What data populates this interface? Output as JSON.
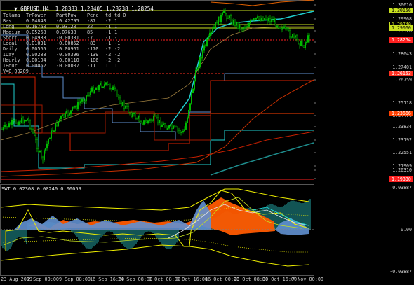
{
  "chart_header": {
    "arrow": "▼",
    "text": "GBPUSD,H4  1.28383 1.28405 1.28238 1.28254"
  },
  "indicator_header": {
    "text": "SWT 0.02308 0.00240 0.00059"
  },
  "table": {
    "columns": [
      "Tolama",
      "TrPower",
      "PartPow",
      "Perc",
      "td",
      "td_0"
    ],
    "rows": [
      [
        "Basic",
        "0.04840",
        "-0.42795",
        "-87",
        "-2",
        "1"
      ],
      [
        "Long",
        "0.16760",
        "0.03120",
        "22",
        "-1",
        "1"
      ],
      [
        "Medium",
        "0.05268",
        "0.07638",
        "85",
        "-1",
        "1"
      ],
      [
        "Short",
        "0.04938",
        "-0.00331",
        "-7",
        "-1",
        "-1"
      ],
      [
        "Local",
        "0.01031",
        "-0.00852",
        "-83",
        "-1",
        "-1"
      ],
      [
        "Daily",
        "0.00565",
        "-0.00961",
        "-170",
        "-2",
        "-2"
      ],
      [
        "IDay",
        "0.00288",
        "-0.00396",
        "-139",
        "-2",
        "-2"
      ],
      [
        "Hourly",
        "0.00104",
        "-0.00110",
        "-106",
        "-2",
        "-2"
      ],
      [
        "IHour",
        "0.00062",
        "-0.00007",
        "-11",
        "1",
        "1"
      ]
    ],
    "footer": "V=0.00209"
  },
  "price_scale": [
    {
      "label": "1.30610",
      "style": "plain"
    },
    {
      "label": "1.29968",
      "style": "plain"
    },
    {
      "label": "1.29326",
      "style": "plain"
    },
    {
      "label": "1.28685",
      "style": "plain"
    },
    {
      "label": "1.28043",
      "style": "plain"
    },
    {
      "label": "1.27401",
      "style": "plain"
    },
    {
      "label": "1.26759",
      "style": "plain"
    },
    {
      "label": "1.25118",
      "style": "plain"
    },
    {
      "label": "1.24476",
      "style": "plain"
    },
    {
      "label": "1.23834",
      "style": "plain"
    },
    {
      "label": "1.23192",
      "style": "plain"
    },
    {
      "label": "1.22551",
      "style": "plain"
    },
    {
      "label": "1.21909",
      "style": "plain"
    },
    {
      "label": "1.21267",
      "style": "plain"
    },
    {
      "label": "1.20310",
      "style": "plain"
    }
  ],
  "price_tags": [
    {
      "label": "1.30156",
      "color": "#c8e020",
      "text_color": "#000"
    },
    {
      "label": "1.29740",
      "color": "#000000",
      "text_color": "#c8e020"
    },
    {
      "label": "1.29060",
      "color": "#c8e020",
      "text_color": "#000"
    },
    {
      "label": "1.28254",
      "color": "#ff2020",
      "text_color": "#fff"
    },
    {
      "label": "1.26153",
      "color": "#ff3020",
      "text_color": "#fff"
    },
    {
      "label": "1.23666",
      "color": "#ff4000",
      "text_color": "#fff"
    },
    {
      "label": "1.19330",
      "color": "#ff2020",
      "text_color": "#fff"
    }
  ],
  "indicator_scale": [
    "0.03887",
    "0.00",
    "-0.03887"
  ],
  "time_axis": [
    "23 Aug 2019",
    "2 Sep 00:00",
    "9 Sep 08:00",
    "16 Sep 16:00",
    "24 Sep 08:00",
    "1 Oct 08:00",
    "8 Oct 16:00",
    "16 Oct 00:00",
    "23 Oct 08:00",
    "30 Oct 16:00",
    "7 Nov 00:00"
  ],
  "colors": {
    "bull": "#00c000",
    "bear": "#00c000",
    "cyan": "#20d0d0",
    "yellow": "#f0f000",
    "lime": "#c8e020",
    "red": "#d82000",
    "orange": "#ff5a00",
    "steel": "#6090d0",
    "teal": "#1e8c8c"
  }
}
